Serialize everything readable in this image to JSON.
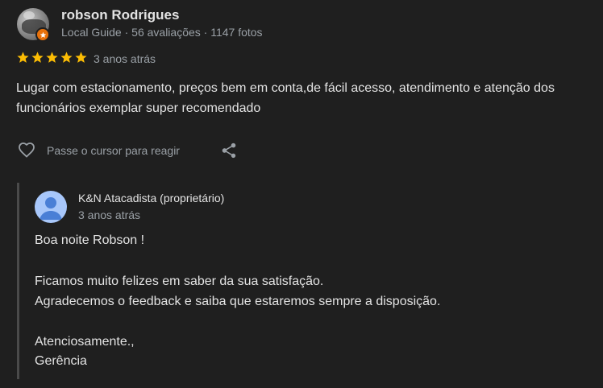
{
  "reviewer": {
    "name": "robson Rodrigues",
    "meta": "Local Guide · 56 avaliações · 1147 fotos"
  },
  "review": {
    "rating": 5,
    "max_rating": 5,
    "date": "3 anos atrás",
    "text_line1": "Lugar com estacionamento, preços bem em conta,de fácil acesso, atendimento e atenção dos",
    "text_line2": "funcionários exemplar super recomendado"
  },
  "actions": {
    "react_hint": "Passe o cursor para reagir"
  },
  "owner_reply": {
    "name": "K&N Atacadista (proprietário)",
    "date": "3 anos atrás",
    "lines": [
      "Boa noite Robson !",
      "Ficamos muito felizes em saber da sua satisfação.",
      "Agradecemos o feedback e saiba que estaremos sempre a disposição.",
      "Atenciosamente.,",
      "Gerência"
    ]
  },
  "colors": {
    "background": "#1f1f1f",
    "star": "#fbbc04",
    "local_guide_badge": "#e8710a",
    "secondary_text": "#9aa0a6",
    "owner_avatar": "#a8c7fa"
  },
  "icons": {
    "like": "heart-outline-icon",
    "share": "share-icon",
    "badge": "local-guide-star-icon"
  }
}
